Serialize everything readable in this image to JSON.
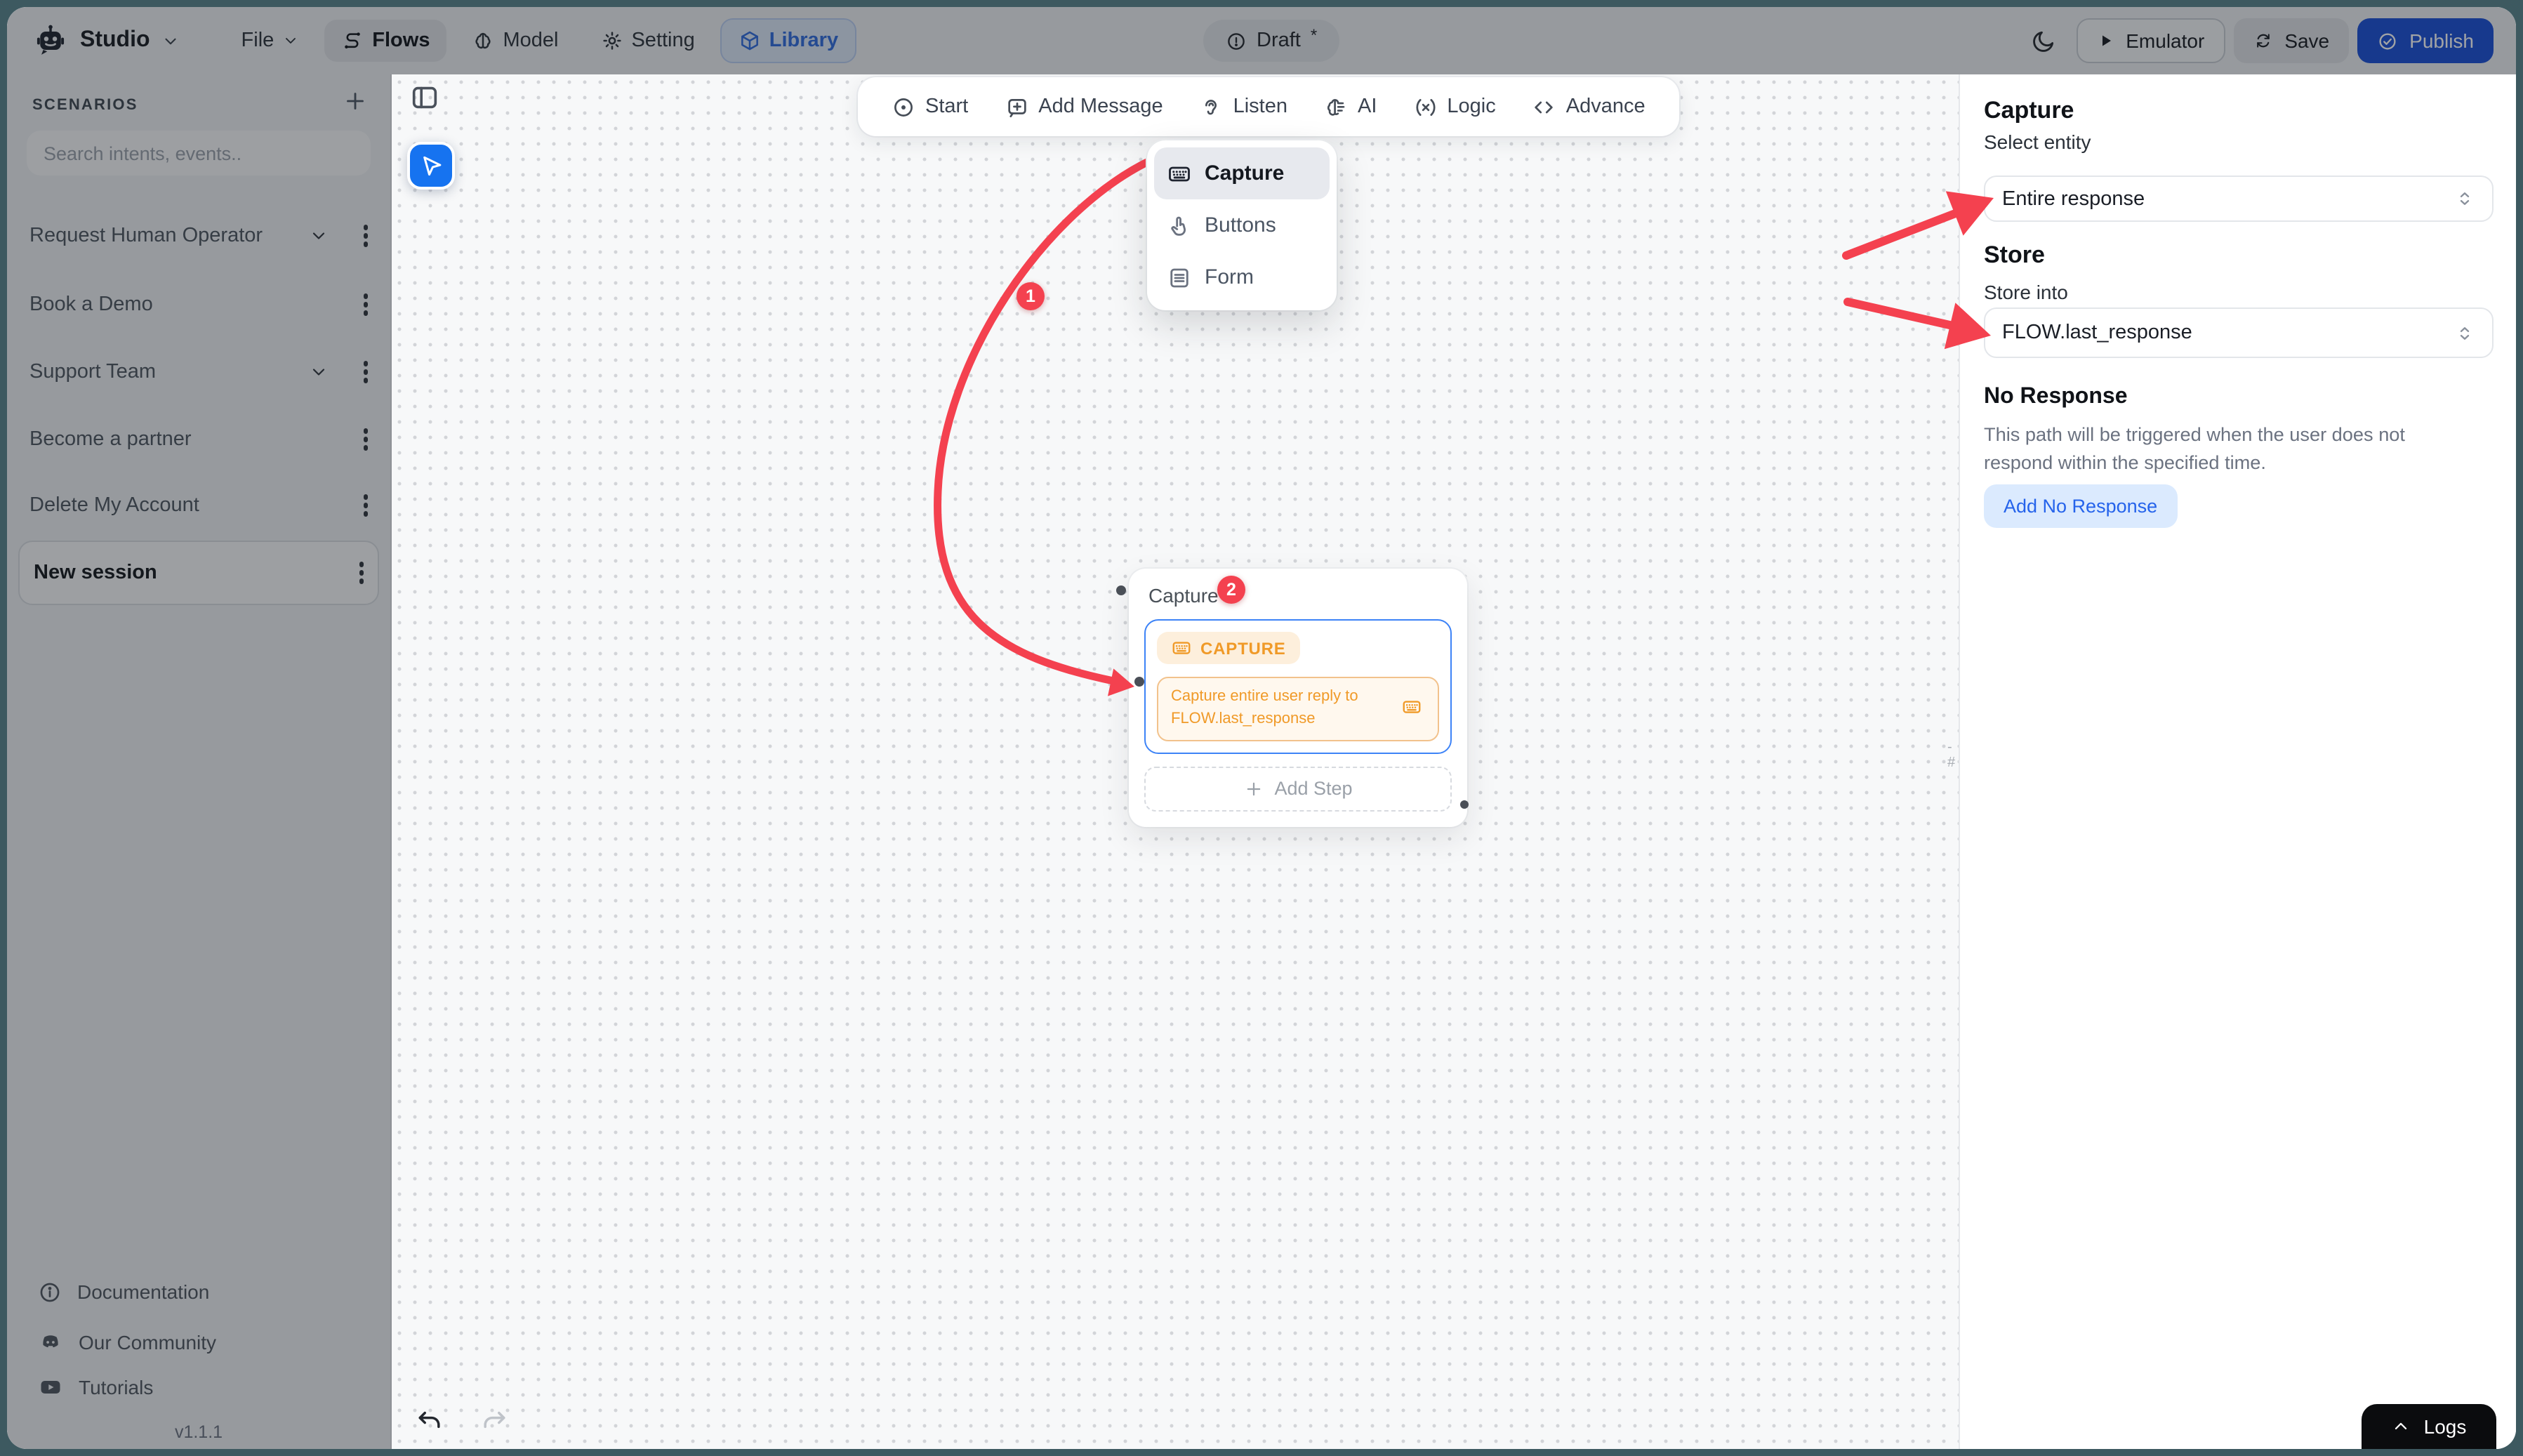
{
  "colors": {
    "accent_blue": "#1673f0",
    "publish_blue": "#1a4fd7",
    "library_blue": "#2f6bde",
    "annotation_red": "#f4414f",
    "capture_orange": "#f09a28",
    "selection_blue": "#3d83f7",
    "frame_teal": "#3d5960"
  },
  "header": {
    "brand": "Studio",
    "menu_file": "File",
    "tab_flows": "Flows",
    "tab_model": "Model",
    "tab_setting": "Setting",
    "tab_library": "Library",
    "status": "Draft",
    "status_mark": "*",
    "emulator": "Emulator",
    "save": "Save",
    "publish": "Publish"
  },
  "sidebar": {
    "title": "SCENARIOS",
    "search_placeholder": "Search intents, events..",
    "items": [
      {
        "label": "Request Human Operator"
      },
      {
        "label": "Book a Demo"
      },
      {
        "label": "Support Team"
      },
      {
        "label": "Become a partner"
      },
      {
        "label": "Delete My Account"
      },
      {
        "label": "New session"
      }
    ],
    "footer": [
      {
        "label": "Documentation"
      },
      {
        "label": "Our Community"
      },
      {
        "label": "Tutorials"
      }
    ],
    "version": "v1.1.1"
  },
  "canvas": {
    "toolbar": [
      {
        "label": "Start"
      },
      {
        "label": "Add Message"
      },
      {
        "label": "Listen"
      },
      {
        "label": "AI"
      },
      {
        "label": "Logic"
      },
      {
        "label": "Advance"
      }
    ],
    "dropdown": [
      {
        "label": "Capture"
      },
      {
        "label": "Buttons"
      },
      {
        "label": "Form"
      }
    ],
    "node": {
      "title": "Capture",
      "tag": "CAPTURE",
      "body": "Capture entire user reply to FLOW.last_response",
      "add_step": "Add Step"
    },
    "annotations": {
      "step1": "1",
      "step2": "2"
    }
  },
  "panel": {
    "title": "Capture",
    "entity_label": "Select entity",
    "entity_value": "Entire response",
    "store_title": "Store",
    "store_label": "Store into",
    "store_value": "FLOW.last_response",
    "no_response_title": "No Response",
    "no_response_desc": "This path will be triggered when the user does not respond within the specified time.",
    "add_no_response": "Add No Response"
  },
  "logs": {
    "label": "Logs"
  }
}
